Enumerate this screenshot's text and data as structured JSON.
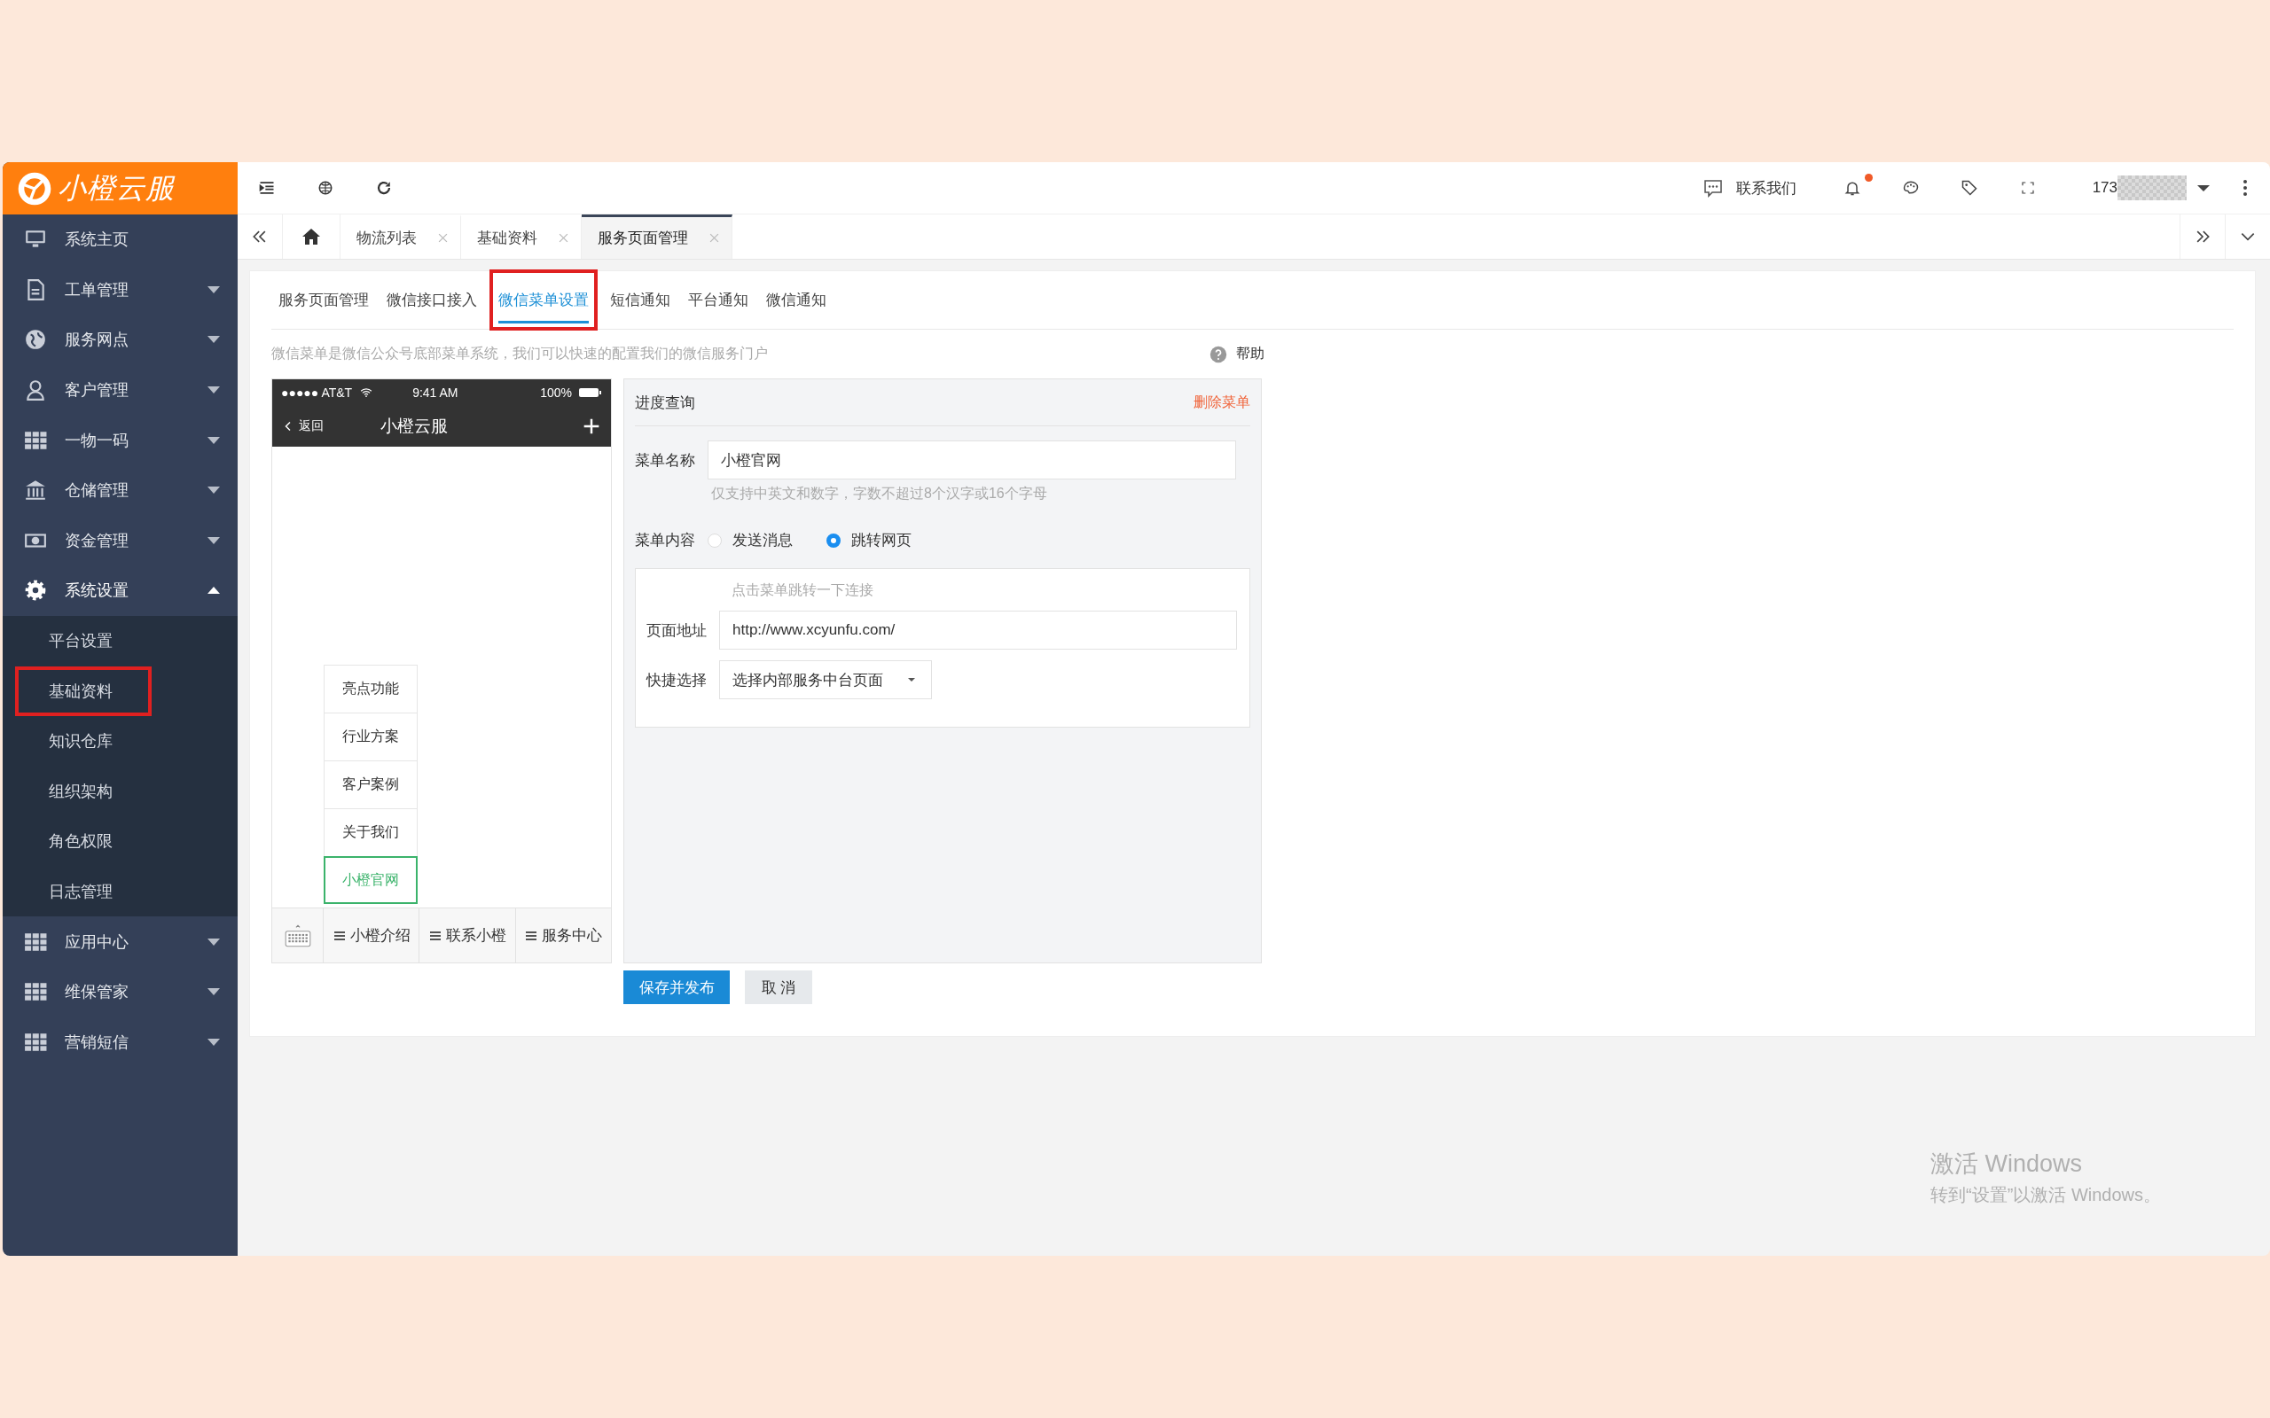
{
  "logo": {
    "text": "小橙云服"
  },
  "header": {
    "contact": "联系我们",
    "notification_dot": true,
    "user": "173"
  },
  "sidebar": {
    "items": [
      {
        "label": "系统主页",
        "kind": "link"
      },
      {
        "label": "工单管理",
        "kind": "group",
        "expanded": false
      },
      {
        "label": "服务网点",
        "kind": "group",
        "expanded": false
      },
      {
        "label": "客户管理",
        "kind": "group",
        "expanded": false
      },
      {
        "label": "一物一码",
        "kind": "group",
        "expanded": false
      },
      {
        "label": "仓储管理",
        "kind": "group",
        "expanded": false
      },
      {
        "label": "资金管理",
        "kind": "group",
        "expanded": false
      },
      {
        "label": "系统设置",
        "kind": "group",
        "expanded": true,
        "children": [
          {
            "label": "平台设置",
            "highlighted": false
          },
          {
            "label": "基础资料",
            "highlighted": true
          },
          {
            "label": "知识仓库",
            "highlighted": false
          },
          {
            "label": "组织架构",
            "highlighted": false
          },
          {
            "label": "角色权限",
            "highlighted": false
          },
          {
            "label": "日志管理",
            "highlighted": false
          }
        ]
      },
      {
        "label": "应用中心",
        "kind": "group",
        "expanded": false
      },
      {
        "label": "维保管家",
        "kind": "group",
        "expanded": false
      },
      {
        "label": "营销短信",
        "kind": "group",
        "expanded": false
      }
    ]
  },
  "page_tabs": [
    {
      "label": "物流列表",
      "selected": false
    },
    {
      "label": "基础资料",
      "selected": false
    },
    {
      "label": "服务页面管理",
      "selected": true
    }
  ],
  "content_tabs": [
    {
      "label": "服务页面管理",
      "selected": false,
      "highlighted": false
    },
    {
      "label": "微信接口接入",
      "selected": false,
      "highlighted": false
    },
    {
      "label": "微信菜单设置",
      "selected": true,
      "highlighted": true
    },
    {
      "label": "短信通知",
      "selected": false,
      "highlighted": false
    },
    {
      "label": "平台通知",
      "selected": false,
      "highlighted": false
    },
    {
      "label": "微信通知",
      "selected": false,
      "highlighted": false
    }
  ],
  "description": "微信菜单是微信公众号底部菜单系统，我们可以快速的配置我们的微信服务门户",
  "help": "帮助",
  "phone": {
    "carrier": "●●●●● AT&T",
    "time": "9:41 AM",
    "battery": "100%",
    "back": "返回",
    "title": "小橙云服",
    "submenu": [
      {
        "label": "亮点功能",
        "selected": false
      },
      {
        "label": "行业方案",
        "selected": false
      },
      {
        "label": "客户案例",
        "selected": false
      },
      {
        "label": "关于我们",
        "selected": false
      },
      {
        "label": "小橙官网",
        "selected": true
      }
    ],
    "menus": [
      "小橙介绍",
      "联系小橙",
      "服务中心"
    ]
  },
  "form": {
    "title": "进度查询",
    "delete": "删除菜单",
    "name_label": "菜单名称",
    "name_value": "小橙官网",
    "name_hint": "仅支持中英文和数字，字数不超过8个汉字或16个字母",
    "content_label": "菜单内容",
    "content_options": [
      {
        "label": "发送消息",
        "selected": false
      },
      {
        "label": "跳转网页",
        "selected": true
      }
    ],
    "link_hint": "点击菜单跳转一下连接",
    "url_label": "页面地址",
    "url_value": "http://www.xcyunfu.com/",
    "quick_label": "快捷选择",
    "quick_value": "选择内部服务中台页面"
  },
  "buttons": {
    "save": "保存并发布",
    "cancel": "取 消"
  },
  "activation": {
    "title": "激活 Windows",
    "subtitle": "转到“设置”以激活 Windows。"
  }
}
